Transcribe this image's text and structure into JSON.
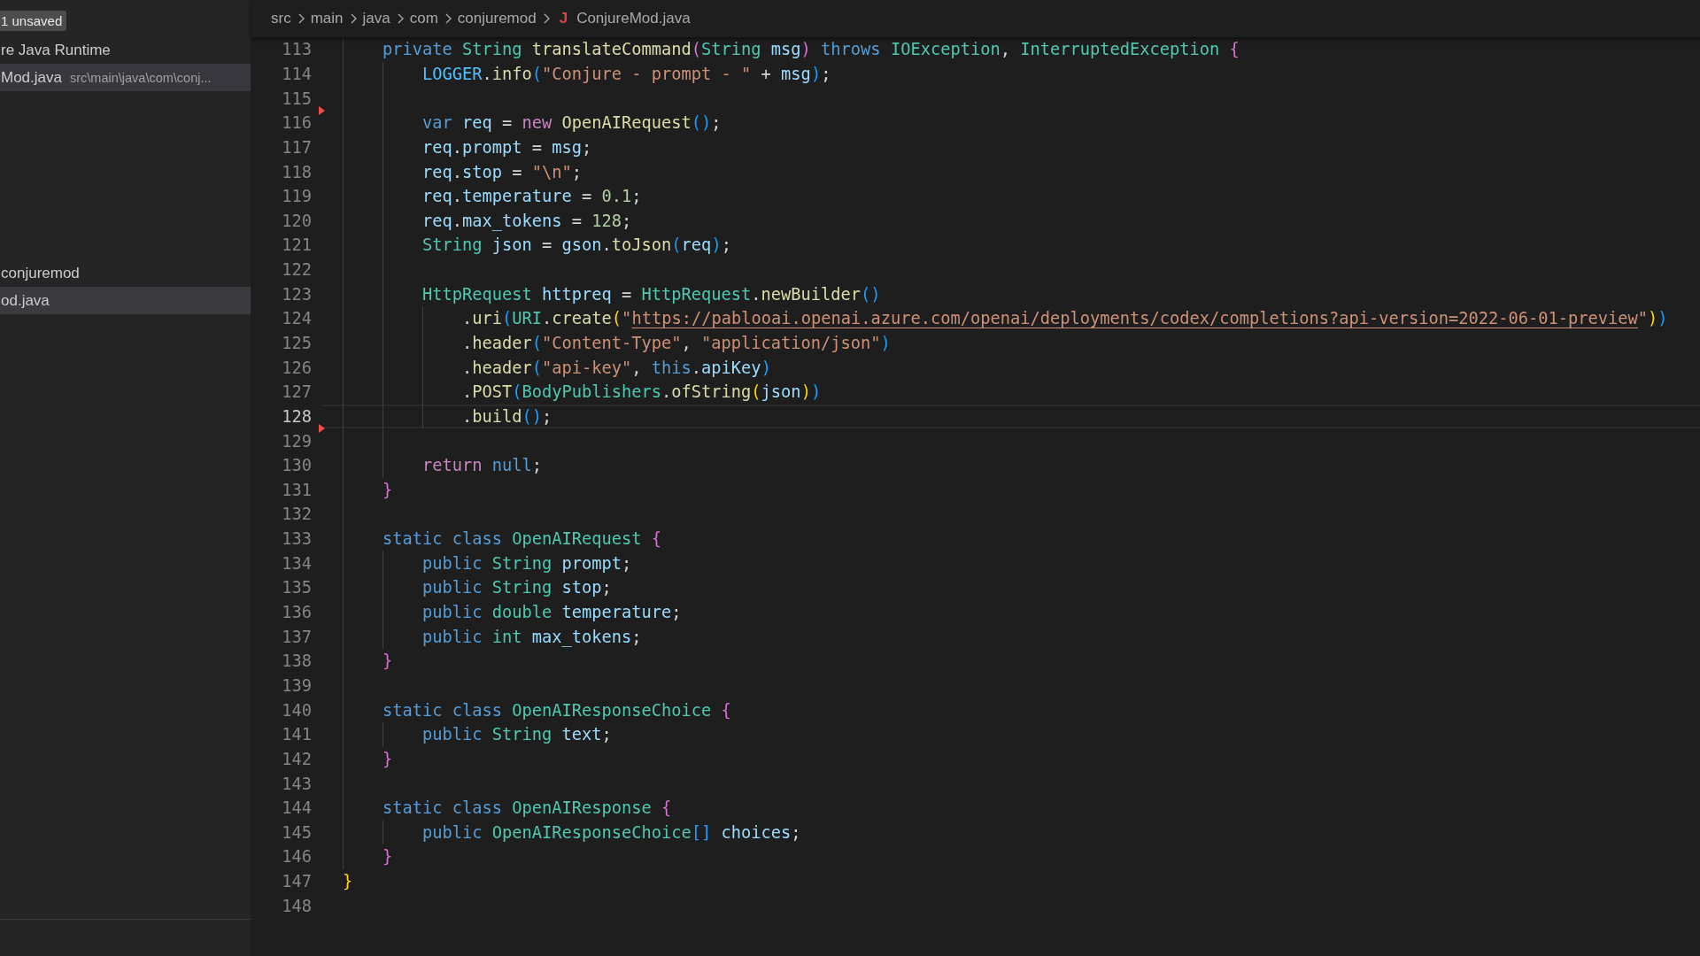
{
  "sidebar": {
    "badge": "1 unsaved",
    "open_editors": [
      {
        "label": "re Java Runtime",
        "selected": false
      },
      {
        "label": "Mod.java",
        "path": "src\\main\\java\\com\\conj...",
        "selected": true
      }
    ],
    "explorer": [
      {
        "label": "conjuremod",
        "selected": false
      },
      {
        "label": "od.java",
        "selected": true
      }
    ]
  },
  "breadcrumb": {
    "parts": [
      "src",
      "main",
      "java",
      "com",
      "conjuremod"
    ],
    "file_icon": "J",
    "file": "ConjureMod.java"
  },
  "editor": {
    "lines": [
      {
        "number": "113",
        "current": false,
        "deleted_marker": false,
        "tokens": [
          {
            "t": "    private ",
            "kind": "keyword"
          },
          {
            "t": "String ",
            "kind": "type"
          },
          {
            "t": "translateCommand",
            "kind": "function"
          },
          {
            "t": "(",
            "kind": "bracket2"
          },
          {
            "t": "String ",
            "kind": "type"
          },
          {
            "t": "msg",
            "kind": "variable"
          },
          {
            "t": ") ",
            "kind": "bracket2"
          },
          {
            "t": "throws ",
            "kind": "keyword"
          },
          {
            "t": "IOException",
            "kind": "type"
          },
          {
            "t": ", ",
            "kind": "punctuation"
          },
          {
            "t": "InterruptedException ",
            "kind": "type"
          },
          {
            "t": "{",
            "kind": "bracket2"
          }
        ]
      },
      {
        "number": "114",
        "current": false,
        "deleted_marker": false,
        "tokens": [
          {
            "t": "        LOGGER",
            "kind": "constant"
          },
          {
            "t": ".",
            "kind": "punctuation"
          },
          {
            "t": "info",
            "kind": "function"
          },
          {
            "t": "(",
            "kind": "bracket3"
          },
          {
            "t": "\"Conjure - prompt - \"",
            "kind": "string"
          },
          {
            "t": " + ",
            "kind": "punctuation"
          },
          {
            "t": "msg",
            "kind": "variable"
          },
          {
            "t": ")",
            "kind": "bracket3"
          },
          {
            "t": ";",
            "kind": "punctuation"
          }
        ]
      },
      {
        "number": "115",
        "current": false,
        "deleted_marker": true
      },
      {
        "number": "116",
        "current": false,
        "deleted_marker": false,
        "tokens": [
          {
            "t": "        var ",
            "kind": "keyword"
          },
          {
            "t": "req",
            "kind": "variable"
          },
          {
            "t": " = ",
            "kind": "punctuation"
          },
          {
            "t": "new ",
            "kind": "control"
          },
          {
            "t": "OpenAIRequest",
            "kind": "function"
          },
          {
            "t": "()",
            "kind": "bracket3"
          },
          {
            "t": ";",
            "kind": "punctuation"
          }
        ]
      },
      {
        "number": "117",
        "current": false,
        "deleted_marker": false,
        "tokens": [
          {
            "t": "        req",
            "kind": "variable"
          },
          {
            "t": ".",
            "kind": "punctuation"
          },
          {
            "t": "prompt",
            "kind": "variable"
          },
          {
            "t": " = ",
            "kind": "punctuation"
          },
          {
            "t": "msg",
            "kind": "variable"
          },
          {
            "t": ";",
            "kind": "punctuation"
          }
        ]
      },
      {
        "number": "118",
        "current": false,
        "deleted_marker": false,
        "tokens": [
          {
            "t": "        req",
            "kind": "variable"
          },
          {
            "t": ".",
            "kind": "punctuation"
          },
          {
            "t": "stop",
            "kind": "variable"
          },
          {
            "t": " = ",
            "kind": "punctuation"
          },
          {
            "t": "\"\\n\"",
            "kind": "string"
          },
          {
            "t": ";",
            "kind": "punctuation"
          }
        ]
      },
      {
        "number": "119",
        "current": false,
        "deleted_marker": false,
        "tokens": [
          {
            "t": "        req",
            "kind": "variable"
          },
          {
            "t": ".",
            "kind": "punctuation"
          },
          {
            "t": "temperature",
            "kind": "variable"
          },
          {
            "t": " = ",
            "kind": "punctuation"
          },
          {
            "t": "0.1",
            "kind": "number"
          },
          {
            "t": ";",
            "kind": "punctuation"
          }
        ]
      },
      {
        "number": "120",
        "current": false,
        "deleted_marker": false,
        "tokens": [
          {
            "t": "        req",
            "kind": "variable"
          },
          {
            "t": ".",
            "kind": "punctuation"
          },
          {
            "t": "max_tokens",
            "kind": "variable"
          },
          {
            "t": " = ",
            "kind": "punctuation"
          },
          {
            "t": "128",
            "kind": "number"
          },
          {
            "t": ";",
            "kind": "punctuation"
          }
        ]
      },
      {
        "number": "121",
        "current": false,
        "deleted_marker": false,
        "tokens": [
          {
            "t": "        String ",
            "kind": "type"
          },
          {
            "t": "json",
            "kind": "variable"
          },
          {
            "t": " = ",
            "kind": "punctuation"
          },
          {
            "t": "gson",
            "kind": "variable"
          },
          {
            "t": ".",
            "kind": "punctuation"
          },
          {
            "t": "toJson",
            "kind": "function"
          },
          {
            "t": "(",
            "kind": "bracket3"
          },
          {
            "t": "req",
            "kind": "variable"
          },
          {
            "t": ")",
            "kind": "bracket3"
          },
          {
            "t": ";",
            "kind": "punctuation"
          }
        ]
      },
      {
        "number": "122",
        "current": false,
        "deleted_marker": false
      },
      {
        "number": "123",
        "current": false,
        "deleted_marker": false,
        "tokens": [
          {
            "t": "        HttpRequest ",
            "kind": "type"
          },
          {
            "t": "httpreq",
            "kind": "variable"
          },
          {
            "t": " = ",
            "kind": "punctuation"
          },
          {
            "t": "HttpRequest",
            "kind": "type"
          },
          {
            "t": ".",
            "kind": "punctuation"
          },
          {
            "t": "newBuilder",
            "kind": "function"
          },
          {
            "t": "()",
            "kind": "bracket3"
          }
        ]
      },
      {
        "number": "124",
        "current": false,
        "deleted_marker": false,
        "tokens": [
          {
            "t": "            .",
            "kind": "punctuation"
          },
          {
            "t": "uri",
            "kind": "function"
          },
          {
            "t": "(",
            "kind": "bracket3"
          },
          {
            "t": "URI",
            "kind": "type"
          },
          {
            "t": ".",
            "kind": "punctuation"
          },
          {
            "t": "create",
            "kind": "function"
          },
          {
            "t": "(",
            "kind": "bracket1"
          },
          {
            "t": "\"",
            "kind": "string"
          },
          {
            "t": "https://pablooai.openai.azure.com/openai/deployments/codex/completions?api-version=2022-06-01-preview",
            "kind": "link"
          },
          {
            "t": "\"",
            "kind": "string"
          },
          {
            "t": ")",
            "kind": "bracket1"
          },
          {
            "t": ")",
            "kind": "bracket3"
          }
        ]
      },
      {
        "number": "125",
        "current": false,
        "deleted_marker": false,
        "tokens": [
          {
            "t": "            .",
            "kind": "punctuation"
          },
          {
            "t": "header",
            "kind": "function"
          },
          {
            "t": "(",
            "kind": "bracket3"
          },
          {
            "t": "\"Content-Type\"",
            "kind": "string"
          },
          {
            "t": ", ",
            "kind": "punctuation"
          },
          {
            "t": "\"application/json\"",
            "kind": "string"
          },
          {
            "t": ")",
            "kind": "bracket3"
          }
        ]
      },
      {
        "number": "126",
        "current": false,
        "deleted_marker": false,
        "tokens": [
          {
            "t": "            .",
            "kind": "punctuation"
          },
          {
            "t": "header",
            "kind": "function"
          },
          {
            "t": "(",
            "kind": "bracket3"
          },
          {
            "t": "\"api-key\"",
            "kind": "string"
          },
          {
            "t": ", ",
            "kind": "punctuation"
          },
          {
            "t": "this",
            "kind": "keyword"
          },
          {
            "t": ".",
            "kind": "punctuation"
          },
          {
            "t": "apiKey",
            "kind": "variable"
          },
          {
            "t": ")",
            "kind": "bracket3"
          }
        ]
      },
      {
        "number": "127",
        "current": false,
        "deleted_marker": false,
        "tokens": [
          {
            "t": "            .",
            "kind": "punctuation"
          },
          {
            "t": "POST",
            "kind": "function"
          },
          {
            "t": "(",
            "kind": "bracket3"
          },
          {
            "t": "BodyPublishers",
            "kind": "type"
          },
          {
            "t": ".",
            "kind": "punctuation"
          },
          {
            "t": "ofString",
            "kind": "function"
          },
          {
            "t": "(",
            "kind": "bracket1"
          },
          {
            "t": "json",
            "kind": "variable"
          },
          {
            "t": ")",
            "kind": "bracket1"
          },
          {
            "t": ")",
            "kind": "bracket3"
          }
        ]
      },
      {
        "number": "128",
        "current": true,
        "deleted_marker": true,
        "tokens": [
          {
            "t": "            .",
            "kind": "punctuation"
          },
          {
            "t": "build",
            "kind": "function"
          },
          {
            "t": "()",
            "kind": "bracket3"
          },
          {
            "t": ";",
            "kind": "punctuation"
          }
        ]
      },
      {
        "number": "129",
        "current": false,
        "deleted_marker": false
      },
      {
        "number": "130",
        "current": false,
        "deleted_marker": false,
        "tokens": [
          {
            "t": "        return ",
            "kind": "control"
          },
          {
            "t": "null",
            "kind": "keyword"
          },
          {
            "t": ";",
            "kind": "punctuation"
          }
        ]
      },
      {
        "number": "131",
        "current": false,
        "deleted_marker": false,
        "tokens": [
          {
            "t": "    }",
            "kind": "bracket2"
          }
        ]
      },
      {
        "number": "132",
        "current": false,
        "deleted_marker": false
      },
      {
        "number": "133",
        "current": false,
        "deleted_marker": false,
        "tokens": [
          {
            "t": "    static class ",
            "kind": "keyword"
          },
          {
            "t": "OpenAIRequest ",
            "kind": "type"
          },
          {
            "t": "{",
            "kind": "bracket2"
          }
        ]
      },
      {
        "number": "134",
        "current": false,
        "deleted_marker": false,
        "tokens": [
          {
            "t": "        public ",
            "kind": "keyword"
          },
          {
            "t": "String ",
            "kind": "type"
          },
          {
            "t": "prompt",
            "kind": "variable"
          },
          {
            "t": ";",
            "kind": "punctuation"
          }
        ]
      },
      {
        "number": "135",
        "current": false,
        "deleted_marker": false,
        "tokens": [
          {
            "t": "        public ",
            "kind": "keyword"
          },
          {
            "t": "String ",
            "kind": "type"
          },
          {
            "t": "stop",
            "kind": "variable"
          },
          {
            "t": ";",
            "kind": "punctuation"
          }
        ]
      },
      {
        "number": "136",
        "current": false,
        "deleted_marker": false,
        "tokens": [
          {
            "t": "        public ",
            "kind": "keyword"
          },
          {
            "t": "double ",
            "kind": "type"
          },
          {
            "t": "temperature",
            "kind": "variable"
          },
          {
            "t": ";",
            "kind": "punctuation"
          }
        ]
      },
      {
        "number": "137",
        "current": false,
        "deleted_marker": false,
        "tokens": [
          {
            "t": "        public ",
            "kind": "keyword"
          },
          {
            "t": "int ",
            "kind": "type"
          },
          {
            "t": "max_tokens",
            "kind": "variable"
          },
          {
            "t": ";",
            "kind": "punctuation"
          }
        ]
      },
      {
        "number": "138",
        "current": false,
        "deleted_marker": false,
        "tokens": [
          {
            "t": "    }",
            "kind": "bracket2"
          }
        ]
      },
      {
        "number": "139",
        "current": false,
        "deleted_marker": false
      },
      {
        "number": "140",
        "current": false,
        "deleted_marker": false,
        "tokens": [
          {
            "t": "    static class ",
            "kind": "keyword"
          },
          {
            "t": "OpenAIResponseChoice ",
            "kind": "type"
          },
          {
            "t": "{",
            "kind": "bracket2"
          }
        ]
      },
      {
        "number": "141",
        "current": false,
        "deleted_marker": false,
        "tokens": [
          {
            "t": "        public ",
            "kind": "keyword"
          },
          {
            "t": "String ",
            "kind": "type"
          },
          {
            "t": "text",
            "kind": "variable"
          },
          {
            "t": ";",
            "kind": "punctuation"
          }
        ]
      },
      {
        "number": "142",
        "current": false,
        "deleted_marker": false,
        "tokens": [
          {
            "t": "    }",
            "kind": "bracket2"
          }
        ]
      },
      {
        "number": "143",
        "current": false,
        "deleted_marker": false
      },
      {
        "number": "144",
        "current": false,
        "deleted_marker": false,
        "tokens": [
          {
            "t": "    static class ",
            "kind": "keyword"
          },
          {
            "t": "OpenAIResponse ",
            "kind": "type"
          },
          {
            "t": "{",
            "kind": "bracket2"
          }
        ]
      },
      {
        "number": "145",
        "current": false,
        "deleted_marker": false,
        "tokens": [
          {
            "t": "        public ",
            "kind": "keyword"
          },
          {
            "t": "OpenAIResponseChoice",
            "kind": "type"
          },
          {
            "t": "[]",
            "kind": "bracket3"
          },
          {
            "t": " choices",
            "kind": "variable"
          },
          {
            "t": ";",
            "kind": "punctuation"
          }
        ]
      },
      {
        "number": "146",
        "current": false,
        "deleted_marker": false,
        "tokens": [
          {
            "t": "    }",
            "kind": "bracket2"
          }
        ]
      },
      {
        "number": "147",
        "current": false,
        "deleted_marker": false,
        "tokens": [
          {
            "t": "}",
            "kind": "bracket1"
          }
        ]
      },
      {
        "number": "148",
        "current": false,
        "deleted_marker": false
      }
    ]
  }
}
